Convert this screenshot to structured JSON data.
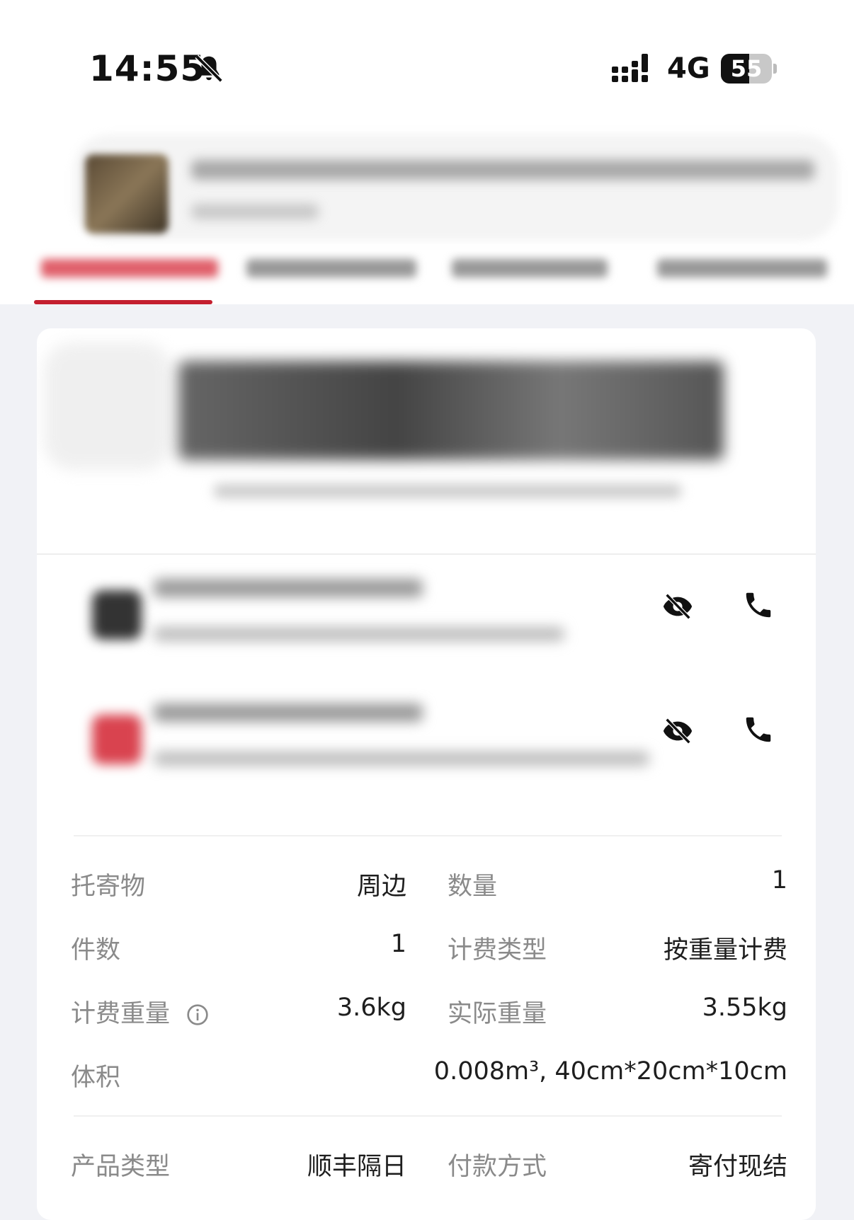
{
  "status_bar": {
    "time": "14:55",
    "network": "4G",
    "battery": "55",
    "battery_level": 0.55
  },
  "details": {
    "item_label": "托寄物",
    "item_value": "周边",
    "quantity_label": "数量",
    "quantity_value": "1",
    "pieces_label": "件数",
    "pieces_value": "1",
    "billing_type_label": "计费类型",
    "billing_type_value": "按重量计费",
    "billed_weight_label": "计费重量",
    "billed_weight_value": "3.6kg",
    "actual_weight_label": "实际重量",
    "actual_weight_value": "3.55kg",
    "volume_label": "体积",
    "volume_value": "0.008m³, 40cm*20cm*10cm",
    "product_type_label": "产品类型",
    "product_type_value": "顺丰隔日",
    "payment_label": "付款方式",
    "payment_value": "寄付现结"
  },
  "colors": {
    "accent": "#c41f2f",
    "receiver_avatar": "#d9434f",
    "sender_avatar": "#333333"
  },
  "icons": [
    "bell-muted-icon",
    "signal-icon",
    "battery-icon",
    "eye-off-icon",
    "phone-icon",
    "info-icon"
  ]
}
